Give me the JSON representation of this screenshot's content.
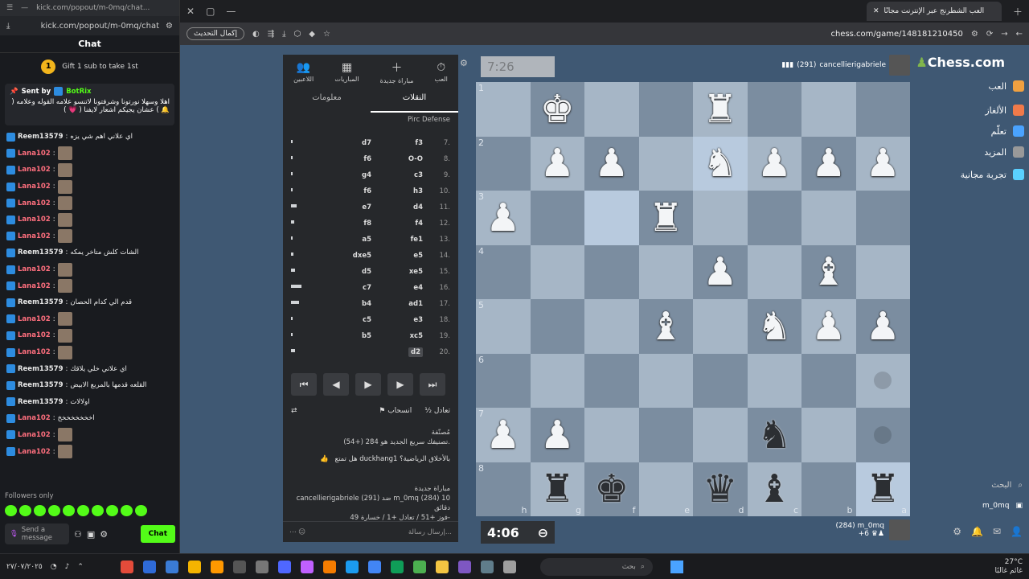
{
  "kick": {
    "title_url": "kick.com/popout/m-0mq/chat...",
    "url": "kick.com/popout/m-0mq/chat",
    "chat_title": "Chat",
    "gift_count": "1",
    "gift_text": "Gift 1 sub to take 1st",
    "pinned_sent_by": "Sent by",
    "pinned_user": "BotRix",
    "pinned_text": "اهلا وسهلا نورتونا وشرفتونا لاتنسو علامه القوله وعلامه ( 🔔 ) عشان يجيكم اشعار لايفنا ( 💗 )",
    "messages": [
      {
        "user": "Reem13579",
        "text": "اي علاني اهم شي يزه",
        "emote": false
      },
      {
        "user": "Lana102",
        "text": "",
        "emote": true
      },
      {
        "user": "Lana102",
        "text": "",
        "emote": true
      },
      {
        "user": "Lana102",
        "text": "",
        "emote": true
      },
      {
        "user": "Lana102",
        "text": "",
        "emote": true
      },
      {
        "user": "Lana102",
        "text": "",
        "emote": true
      },
      {
        "user": "Lana102",
        "text": "",
        "emote": true
      },
      {
        "user": "Reem13579",
        "text": "الشات كلش متاخر يمكه",
        "emote": false
      },
      {
        "user": "Lana102",
        "text": "",
        "emote": true
      },
      {
        "user": "Lana102",
        "text": "",
        "emote": true
      },
      {
        "user": "Reem13579",
        "text": "قدم الي كدام الحصان",
        "emote": false
      },
      {
        "user": "Lana102",
        "text": "",
        "emote": true
      },
      {
        "user": "Lana102",
        "text": "",
        "emote": true
      },
      {
        "user": "Lana102",
        "text": "",
        "emote": true
      },
      {
        "user": "Reem13579",
        "text": "اي علاني خلي يلاقك",
        "emote": false
      },
      {
        "user": "Reem13579",
        "text": "القلعه قدمها بالمربع الابيض",
        "emote": false
      },
      {
        "user": "Reem13579",
        "text": "اولالات",
        "emote": false
      },
      {
        "user": "Lana102",
        "text": "اخخخخخخخخ",
        "emote": false
      },
      {
        "user": "Lana102",
        "text": "",
        "emote": true
      },
      {
        "user": "Lana102",
        "text": "",
        "emote": true
      }
    ],
    "followers_only": "Followers only",
    "send_placeholder": "Send a message",
    "chat_button": "Chat"
  },
  "browser": {
    "tab_title": "العب الشطرنج عبر الإنترنت مجانًا",
    "update_label": "إكمال التحديث",
    "url": "chess.com/game/148181210450"
  },
  "sidebar": {
    "logo": "Chess.com",
    "nav": [
      {
        "label": "العب",
        "color": "#f0a040"
      },
      {
        "label": "الألغاز",
        "color": "#f07a4a"
      },
      {
        "label": "تعلّم",
        "color": "#4aa3ff"
      },
      {
        "label": "المزيد",
        "color": "#999999"
      },
      {
        "label": "تجربة مجانية",
        "color": "#5ad0ff"
      }
    ],
    "search_label": "البحث",
    "me": "m_0mq"
  },
  "panel": {
    "tools": [
      {
        "icon": "⏱",
        "label": "العب"
      },
      {
        "icon": "＋",
        "label": "مباراة جديدة"
      },
      {
        "icon": "▦",
        "label": "المباريات"
      },
      {
        "icon": "👥",
        "label": "اللاعبين"
      }
    ],
    "tab_moves": "النقلات",
    "tab_info": "معلومات",
    "opening": "Pirc Defense",
    "moves": [
      {
        "num": "7.",
        "w": "f3",
        "b": "d7",
        "bar": 0.02
      },
      {
        "num": "8.",
        "w": "O-O",
        "b": "f6",
        "bar": 0.02
      },
      {
        "num": "9.",
        "w": "c3",
        "b": "g4",
        "bar": 0.03
      },
      {
        "num": "10.",
        "w": "h3",
        "b": "f6",
        "bar": 0.03
      },
      {
        "num": "11.",
        "w": "d4",
        "b": "e7",
        "bar": 0.12
      },
      {
        "num": "12.",
        "w": "f4",
        "b": "f8",
        "bar": 0.06
      },
      {
        "num": "13.",
        "w": "fe1",
        "b": "a5",
        "bar": 0.02
      },
      {
        "num": "14.",
        "w": "e5",
        "b": "dxe5",
        "bar": 0.05
      },
      {
        "num": "15.",
        "w": "xe5",
        "b": "d5",
        "bar": 0.08
      },
      {
        "num": "16.",
        "w": "e4",
        "b": "c7",
        "bar": 0.22
      },
      {
        "num": "17.",
        "w": "ad1",
        "b": "b4",
        "bar": 0.16
      },
      {
        "num": "18.",
        "w": "e3",
        "b": "c5",
        "bar": 0.02
      },
      {
        "num": "19.",
        "w": "xc5",
        "b": "b5",
        "bar": 0.02
      },
      {
        "num": "20.",
        "w": "d2",
        "b": "",
        "bar": 0.08
      }
    ],
    "draw_label": "تعادل",
    "resign_label": "انسحاب",
    "rating_note_1": "مُصنّفة",
    "rating_note_2": "تصنيفك سريع الجديد هو 284 (+54).",
    "question": "هل تمتع duckhang1 بالأخلاق الرياضية؟",
    "new_game_title": "مباراة جديدة",
    "new_game_players": "cancellierigabriele (291) ضد m_0mq (284) 10 دقائق",
    "new_game_record": "فوز +51 / تعادل +1 / خسارة 49-",
    "message_placeholder": "إرسال رسالة..."
  },
  "game": {
    "opponent_clock": "7:26",
    "opponent_name": "cancellierigabriele",
    "opponent_rating": "(291)",
    "my_clock": "4:06",
    "my_name": "m_0mq",
    "my_rating": "(284)",
    "my_material": "+6",
    "ranks": [
      "1",
      "2",
      "3",
      "4",
      "5",
      "6",
      "7",
      "8"
    ],
    "files": [
      "h",
      "g",
      "f",
      "e",
      "d",
      "c",
      "b",
      "a"
    ],
    "board": [
      [
        "",
        "wK",
        "",
        "",
        "wR",
        "",
        "",
        ""
      ],
      [
        "",
        "wP",
        "wP",
        "",
        "wN",
        "wP",
        "wP",
        "wP"
      ],
      [
        "wP",
        "",
        "",
        "wR",
        "",
        "",
        "",
        ""
      ],
      [
        "",
        "",
        "",
        "",
        "wP",
        "",
        "wB",
        ""
      ],
      [
        "",
        "",
        "",
        "wB",
        "",
        "wN",
        "wP",
        "wP"
      ],
      [
        "",
        "",
        "",
        "",
        "",
        "",
        "",
        "."
      ],
      [
        "wP",
        "wP",
        "",
        "",
        "",
        "bN",
        "",
        "."
      ],
      [
        "",
        "bR",
        "bK",
        "",
        "bQ",
        "bB",
        "",
        "bR"
      ]
    ],
    "highlight": [
      [
        2,
        2
      ],
      [
        1,
        4
      ],
      [
        7,
        7
      ]
    ]
  },
  "taskbar": {
    "date": "٢٧/٠٧/٢٠٢٥",
    "search_label": "بحث",
    "temp": "27°C",
    "weather": "غائم غالبًا",
    "app_colors": [
      "#e34b3a",
      "#2f6bd8",
      "#3a7bd5",
      "#f4b400",
      "#ff9800",
      "#555555",
      "#777777",
      "#4f67ff",
      "#c060ff",
      "#f57c00",
      "#1b9bf0",
      "#4285f4",
      "#0f9d58",
      "#4caf50",
      "#f4c542",
      "#7e57c2",
      "#607d8b",
      "#9e9e9e"
    ]
  }
}
